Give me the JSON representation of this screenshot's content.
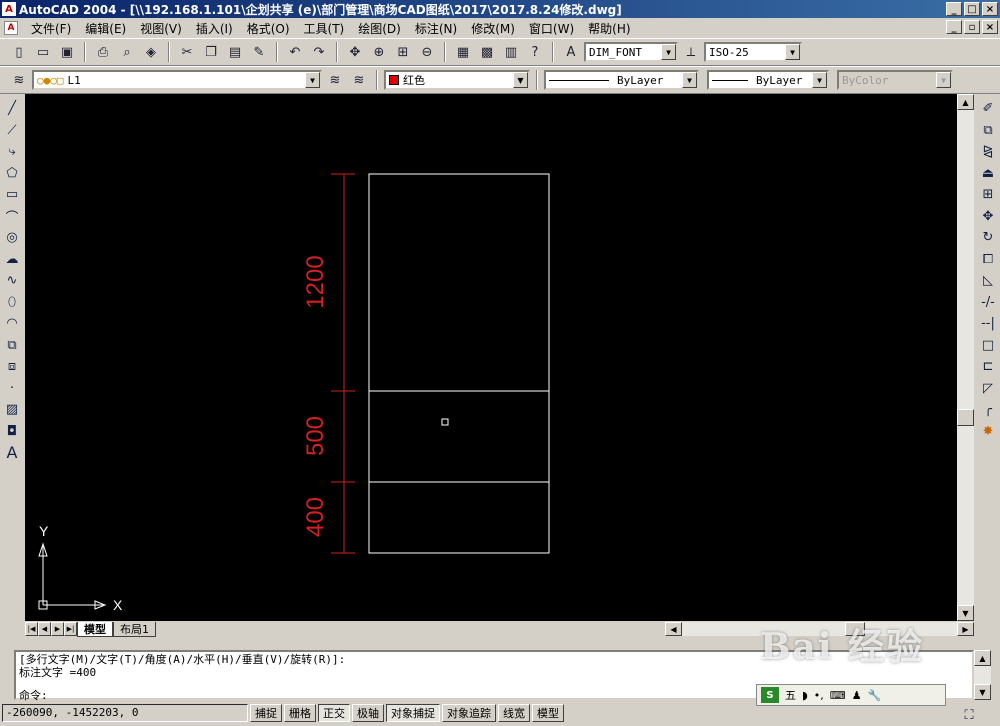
{
  "app": {
    "title": "AutoCAD 2004 - [\\\\192.168.1.101\\企划共享 (e)\\部门管理\\商场CAD图纸\\2017\\2017.8.24修改.dwg]",
    "icon_label": "A"
  },
  "menu": [
    "文件(F)",
    "编辑(E)",
    "视图(V)",
    "插入(I)",
    "格式(O)",
    "工具(T)",
    "绘图(D)",
    "标注(N)",
    "修改(M)",
    "窗口(W)",
    "帮助(H)"
  ],
  "toolbar": {
    "text_style": "DIM_FONT",
    "dim_style": "ISO-25"
  },
  "properties": {
    "layer": "L1",
    "color_name": "红色",
    "color_hex": "#e00000",
    "linetype": "ByLayer",
    "lineweight": "ByLayer",
    "plotstyle": "ByColor"
  },
  "drawing": {
    "dimensions": [
      "1200",
      "500",
      "400"
    ],
    "dim_color": "#d42020",
    "line_color": "#ffffff",
    "axis_x": "X",
    "axis_y": "Y"
  },
  "tabs": [
    "模型",
    "布局1"
  ],
  "command": {
    "line1": "[多行文字(M)/文字(T)/角度(A)/水平(H)/垂直(V)/旋转(R)]:",
    "line2": "标注文字 =400",
    "prompt": "命令:"
  },
  "status": {
    "coords": "-260090, -1452203, 0",
    "toggles": [
      "捕捉",
      "栅格",
      "正交",
      "极轴",
      "对象捕捉",
      "对象追踪",
      "线宽",
      "模型"
    ]
  },
  "ime": {
    "label": "五"
  },
  "watermark": "Bai 经验"
}
